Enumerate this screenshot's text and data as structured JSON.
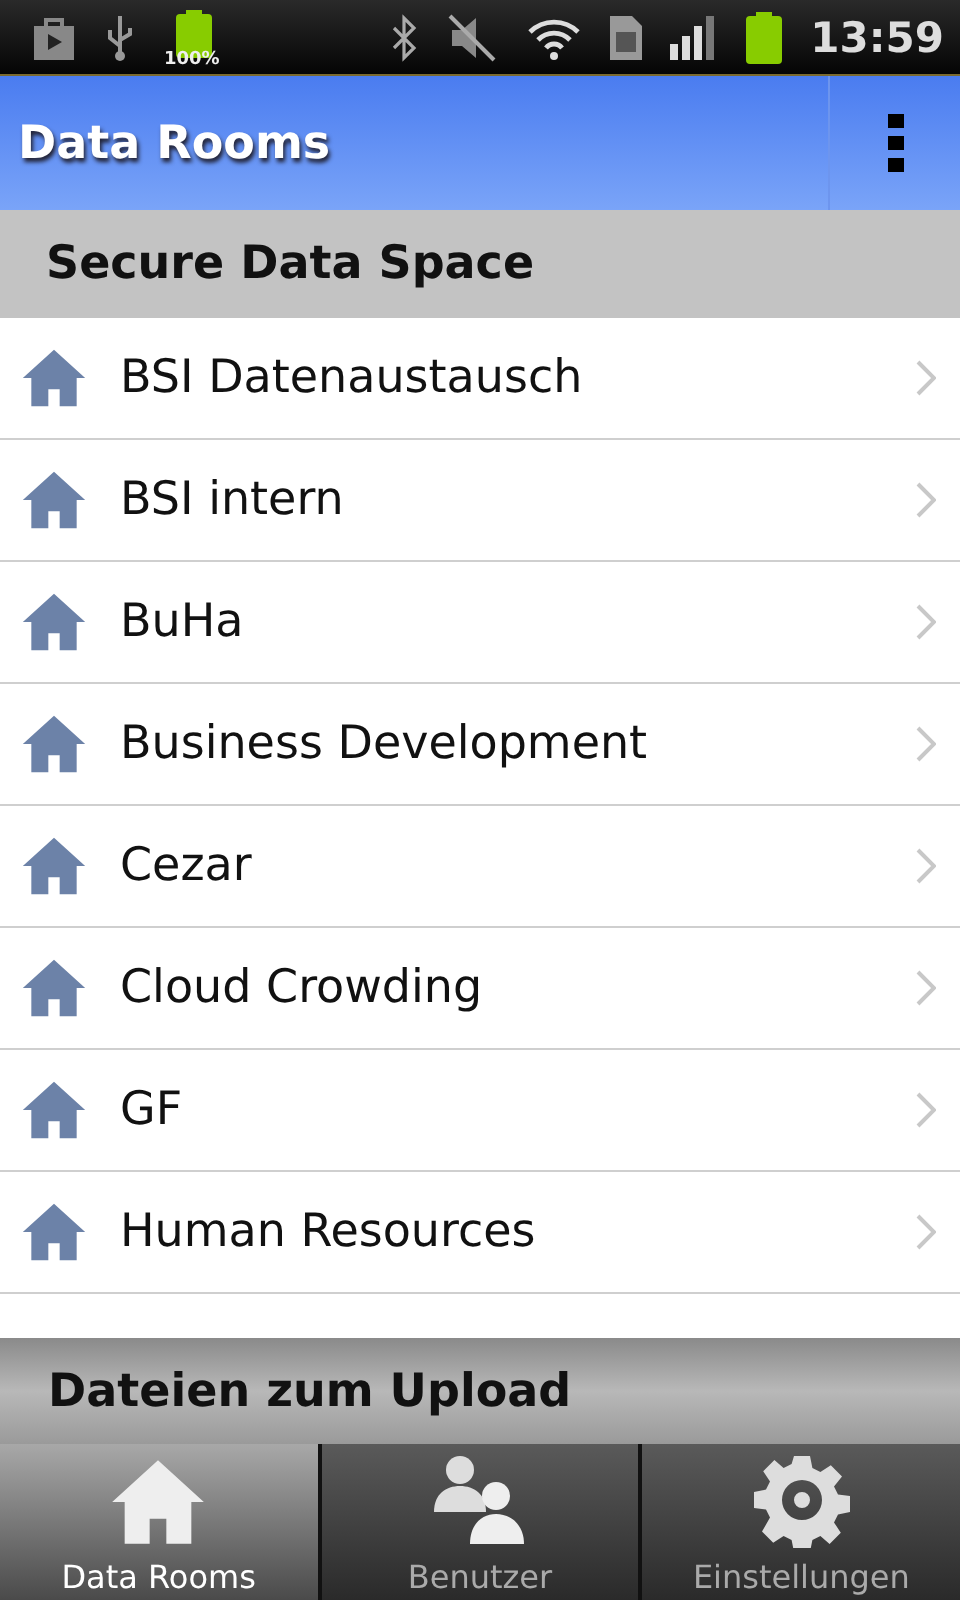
{
  "status_bar": {
    "battery_percent": "100%",
    "time": "13:59"
  },
  "action_bar": {
    "title": "Data Rooms"
  },
  "section": {
    "title": "Secure Data Space"
  },
  "rooms": [
    {
      "name": "BSI Datenaustausch"
    },
    {
      "name": "BSI intern"
    },
    {
      "name": "BuHa"
    },
    {
      "name": "Business Development"
    },
    {
      "name": "Cezar"
    },
    {
      "name": "Cloud Crowding"
    },
    {
      "name": "GF"
    },
    {
      "name": "Human Resources"
    }
  ],
  "upload_bar": {
    "title": "Dateien zum Upload"
  },
  "tabs": [
    {
      "label": "Data Rooms",
      "kind": "home",
      "selected": true
    },
    {
      "label": "Benutzer",
      "kind": "users",
      "selected": false
    },
    {
      "label": "Einstellungen",
      "kind": "settings",
      "selected": false
    }
  ]
}
